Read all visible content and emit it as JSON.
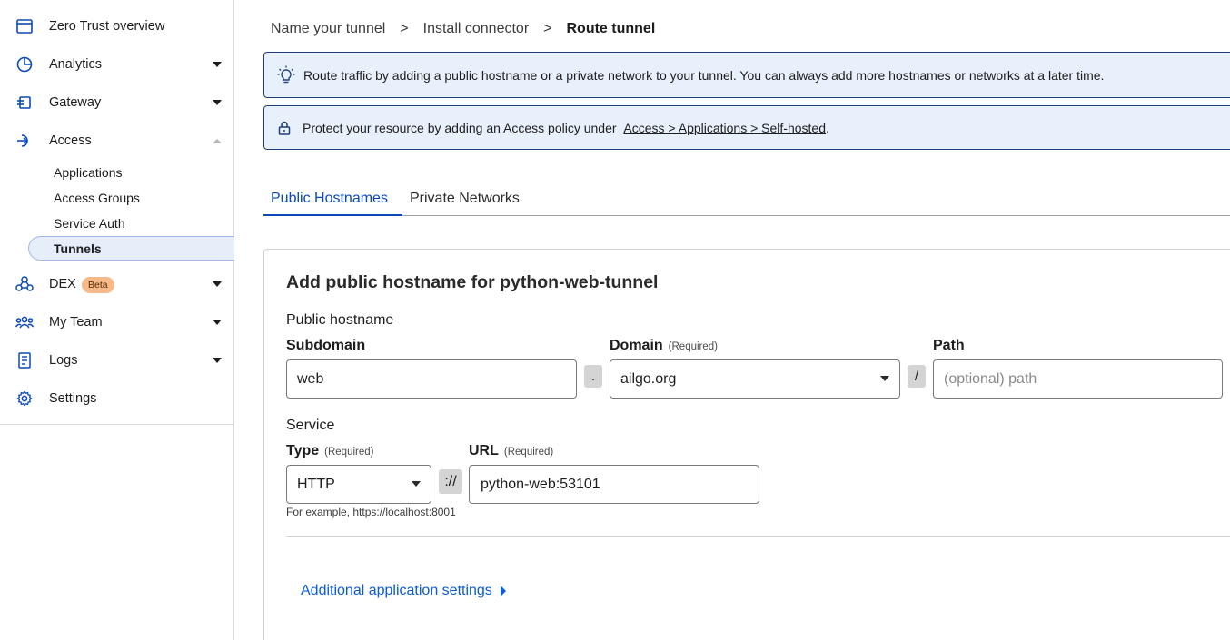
{
  "sidebar": {
    "items": [
      {
        "label": "Zero Trust overview",
        "icon": "browser-window-icon"
      },
      {
        "label": "Analytics",
        "icon": "pie-chart-icon"
      },
      {
        "label": "Gateway",
        "icon": "gateway-icon"
      },
      {
        "label": "Access",
        "icon": "access-icon"
      },
      {
        "label": "DEX",
        "icon": "dex-network-icon",
        "badge": "Beta"
      },
      {
        "label": "My Team",
        "icon": "team-icon"
      },
      {
        "label": "Logs",
        "icon": "logs-icon"
      },
      {
        "label": "Settings",
        "icon": "gear-icon"
      }
    ],
    "access_sub": [
      {
        "label": "Applications"
      },
      {
        "label": "Access Groups"
      },
      {
        "label": "Service Auth"
      },
      {
        "label": "Tunnels",
        "active": true
      }
    ],
    "accent_color": "#0b4ab8",
    "badge_color": "#f5b98a"
  },
  "breadcrumb": {
    "steps": [
      "Name your tunnel",
      "Install connector",
      "Route tunnel"
    ],
    "separator": ">"
  },
  "banners": {
    "info_text": "Route traffic by adding a public hostname or a private network to your tunnel. You can always add more hostnames or networks at a later time.",
    "access_prefix": "Protect your resource by adding an Access policy under",
    "access_link": "Access > Applications > Self-hosted",
    "access_suffix": "."
  },
  "tabs": [
    "Public Hostnames",
    "Private Networks"
  ],
  "form": {
    "title": "Add public hostname for python-web-tunnel",
    "public_hostname_label": "Public hostname",
    "subdomain_label": "Subdomain",
    "subdomain_value": "web",
    "dot": ".",
    "domain_label": "Domain",
    "required": "(Required)",
    "domain_value": "ailgo.org",
    "slash": "/",
    "path_label": "Path",
    "path_placeholder": "(optional) path",
    "service_label": "Service",
    "type_label": "Type",
    "type_value": "HTTP",
    "scheme_sep": "://",
    "url_label": "URL",
    "url_value": "python-web:53101",
    "help_text": "For example, https://localhost:8001",
    "additional_link": "Additional application settings"
  }
}
